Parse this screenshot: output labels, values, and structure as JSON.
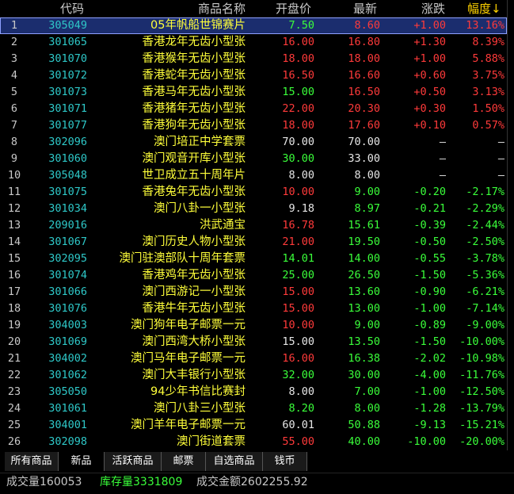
{
  "header": {
    "code": "代码",
    "name": "商品名称",
    "open": "开盘价",
    "latest": "最新",
    "change": "涨跌",
    "pct": "幅度",
    "sort_arrow": "↓"
  },
  "rows": [
    {
      "idx": "1",
      "code": "305049",
      "name": "05年帆船世锦赛片",
      "open": "7.50",
      "latest": "8.60",
      "change": "+1.00",
      "pct": "13.16%",
      "open_dir": "down",
      "latest_dir": "up",
      "change_dir": "up",
      "pct_dir": "up"
    },
    {
      "idx": "2",
      "code": "301065",
      "name": "香港龙年无齿小型张",
      "open": "16.00",
      "latest": "16.80",
      "change": "+1.30",
      "pct": "8.39%",
      "open_dir": "up",
      "latest_dir": "up",
      "change_dir": "up",
      "pct_dir": "up"
    },
    {
      "idx": "3",
      "code": "301070",
      "name": "香港猴年无齿小型张",
      "open": "18.00",
      "latest": "18.00",
      "change": "+1.00",
      "pct": "5.88%",
      "open_dir": "up",
      "latest_dir": "up",
      "change_dir": "up",
      "pct_dir": "up"
    },
    {
      "idx": "4",
      "code": "301072",
      "name": "香港蛇年无齿小型张",
      "open": "16.50",
      "latest": "16.60",
      "change": "+0.60",
      "pct": "3.75%",
      "open_dir": "up",
      "latest_dir": "up",
      "change_dir": "up",
      "pct_dir": "up"
    },
    {
      "idx": "5",
      "code": "301073",
      "name": "香港马年无齿小型张",
      "open": "15.00",
      "latest": "16.50",
      "change": "+0.50",
      "pct": "3.13%",
      "open_dir": "down",
      "latest_dir": "up",
      "change_dir": "up",
      "pct_dir": "up"
    },
    {
      "idx": "6",
      "code": "301071",
      "name": "香港猪年无齿小型张",
      "open": "22.00",
      "latest": "20.30",
      "change": "+0.30",
      "pct": "1.50%",
      "open_dir": "up",
      "latest_dir": "up",
      "change_dir": "up",
      "pct_dir": "up"
    },
    {
      "idx": "7",
      "code": "301077",
      "name": "香港狗年无齿小型张",
      "open": "18.00",
      "latest": "17.60",
      "change": "+0.10",
      "pct": "0.57%",
      "open_dir": "up",
      "latest_dir": "up",
      "change_dir": "up",
      "pct_dir": "up"
    },
    {
      "idx": "8",
      "code": "302096",
      "name": "澳门培正中学套票",
      "open": "70.00",
      "latest": "70.00",
      "change": "—",
      "pct": "—",
      "open_dir": "flat",
      "latest_dir": "flat",
      "change_dir": "flat",
      "pct_dir": "flat"
    },
    {
      "idx": "9",
      "code": "301060",
      "name": "澳门观音开库小型张",
      "open": "30.00",
      "latest": "33.00",
      "change": "—",
      "pct": "—",
      "open_dir": "down",
      "latest_dir": "flat",
      "change_dir": "flat",
      "pct_dir": "flat"
    },
    {
      "idx": "10",
      "code": "305048",
      "name": "世卫成立五十周年片",
      "open": "8.00",
      "latest": "8.00",
      "change": "—",
      "pct": "—",
      "open_dir": "flat",
      "latest_dir": "flat",
      "change_dir": "flat",
      "pct_dir": "flat"
    },
    {
      "idx": "11",
      "code": "301075",
      "name": "香港兔年无齿小型张",
      "open": "10.00",
      "latest": "9.00",
      "change": "-0.20",
      "pct": "-2.17%",
      "open_dir": "up",
      "latest_dir": "down",
      "change_dir": "down",
      "pct_dir": "down"
    },
    {
      "idx": "12",
      "code": "301034",
      "name": "澳门八卦一小型张",
      "open": "9.18",
      "latest": "8.97",
      "change": "-0.21",
      "pct": "-2.29%",
      "open_dir": "flat",
      "latest_dir": "down",
      "change_dir": "down",
      "pct_dir": "down"
    },
    {
      "idx": "13",
      "code": "209016",
      "name": "洪武通宝",
      "open": "16.78",
      "latest": "15.61",
      "change": "-0.39",
      "pct": "-2.44%",
      "open_dir": "up",
      "latest_dir": "down",
      "change_dir": "down",
      "pct_dir": "down"
    },
    {
      "idx": "14",
      "code": "301067",
      "name": "澳门历史人物小型张",
      "open": "21.00",
      "latest": "19.50",
      "change": "-0.50",
      "pct": "-2.50%",
      "open_dir": "up",
      "latest_dir": "down",
      "change_dir": "down",
      "pct_dir": "down"
    },
    {
      "idx": "15",
      "code": "302095",
      "name": "澳门驻澳部队十周年套票",
      "open": "14.01",
      "latest": "14.00",
      "change": "-0.55",
      "pct": "-3.78%",
      "open_dir": "down",
      "latest_dir": "down",
      "change_dir": "down",
      "pct_dir": "down"
    },
    {
      "idx": "16",
      "code": "301074",
      "name": "香港鸡年无齿小型张",
      "open": "25.00",
      "latest": "26.50",
      "change": "-1.50",
      "pct": "-5.36%",
      "open_dir": "down",
      "latest_dir": "down",
      "change_dir": "down",
      "pct_dir": "down"
    },
    {
      "idx": "17",
      "code": "301066",
      "name": "澳门西游记一小型张",
      "open": "15.00",
      "latest": "13.60",
      "change": "-0.90",
      "pct": "-6.21%",
      "open_dir": "up",
      "latest_dir": "down",
      "change_dir": "down",
      "pct_dir": "down"
    },
    {
      "idx": "18",
      "code": "301076",
      "name": "香港牛年无齿小型张",
      "open": "15.00",
      "latest": "13.00",
      "change": "-1.00",
      "pct": "-7.14%",
      "open_dir": "up",
      "latest_dir": "down",
      "change_dir": "down",
      "pct_dir": "down"
    },
    {
      "idx": "19",
      "code": "304003",
      "name": "澳门狗年电子邮票一元",
      "open": "10.00",
      "latest": "9.00",
      "change": "-0.89",
      "pct": "-9.00%",
      "open_dir": "up",
      "latest_dir": "down",
      "change_dir": "down",
      "pct_dir": "down"
    },
    {
      "idx": "20",
      "code": "301069",
      "name": "澳门西湾大桥小型张",
      "open": "15.00",
      "latest": "13.50",
      "change": "-1.50",
      "pct": "-10.00%",
      "open_dir": "flat",
      "latest_dir": "down",
      "change_dir": "down",
      "pct_dir": "down"
    },
    {
      "idx": "21",
      "code": "304002",
      "name": "澳门马年电子邮票一元",
      "open": "16.00",
      "latest": "16.38",
      "change": "-2.02",
      "pct": "-10.98%",
      "open_dir": "up",
      "latest_dir": "down",
      "change_dir": "down",
      "pct_dir": "down"
    },
    {
      "idx": "22",
      "code": "301062",
      "name": "澳门大丰银行小型张",
      "open": "32.00",
      "latest": "30.00",
      "change": "-4.00",
      "pct": "-11.76%",
      "open_dir": "down",
      "latest_dir": "down",
      "change_dir": "down",
      "pct_dir": "down"
    },
    {
      "idx": "23",
      "code": "305050",
      "name": "94少年书信比赛封",
      "open": "8.00",
      "latest": "7.00",
      "change": "-1.00",
      "pct": "-12.50%",
      "open_dir": "flat",
      "latest_dir": "down",
      "change_dir": "down",
      "pct_dir": "down"
    },
    {
      "idx": "24",
      "code": "301061",
      "name": "澳门八卦三小型张",
      "open": "8.20",
      "latest": "8.00",
      "change": "-1.28",
      "pct": "-13.79%",
      "open_dir": "down",
      "latest_dir": "down",
      "change_dir": "down",
      "pct_dir": "down"
    },
    {
      "idx": "25",
      "code": "304001",
      "name": "澳门羊年电子邮票一元",
      "open": "60.01",
      "latest": "50.88",
      "change": "-9.13",
      "pct": "-15.21%",
      "open_dir": "flat",
      "latest_dir": "down",
      "change_dir": "down",
      "pct_dir": "down"
    },
    {
      "idx": "26",
      "code": "302098",
      "name": "澳门街道套票",
      "open": "55.00",
      "latest": "40.00",
      "change": "-10.00",
      "pct": "-20.00%",
      "open_dir": "up",
      "latest_dir": "down",
      "change_dir": "down",
      "pct_dir": "down"
    }
  ],
  "selected_row": 0,
  "tabs": [
    {
      "label": "所有商品",
      "active": false
    },
    {
      "label": "新品",
      "active": true
    },
    {
      "label": "活跃商品",
      "active": false
    },
    {
      "label": "邮票",
      "active": false
    },
    {
      "label": "自选商品",
      "active": false
    },
    {
      "label": "钱币",
      "active": false
    }
  ],
  "status": {
    "volume_label": "成交量",
    "volume": "160053",
    "stock_label": "库存量",
    "stock": "3331809",
    "amount_label": "成交金额",
    "amount": "2602255.92"
  },
  "colors": {
    "up": "#ff3a3a",
    "down": "#3aff3a",
    "flat": "#e6e6e6",
    "name": "#ffff3a",
    "code": "#2ec8c8",
    "selected_bg": "#1b2d6e"
  }
}
